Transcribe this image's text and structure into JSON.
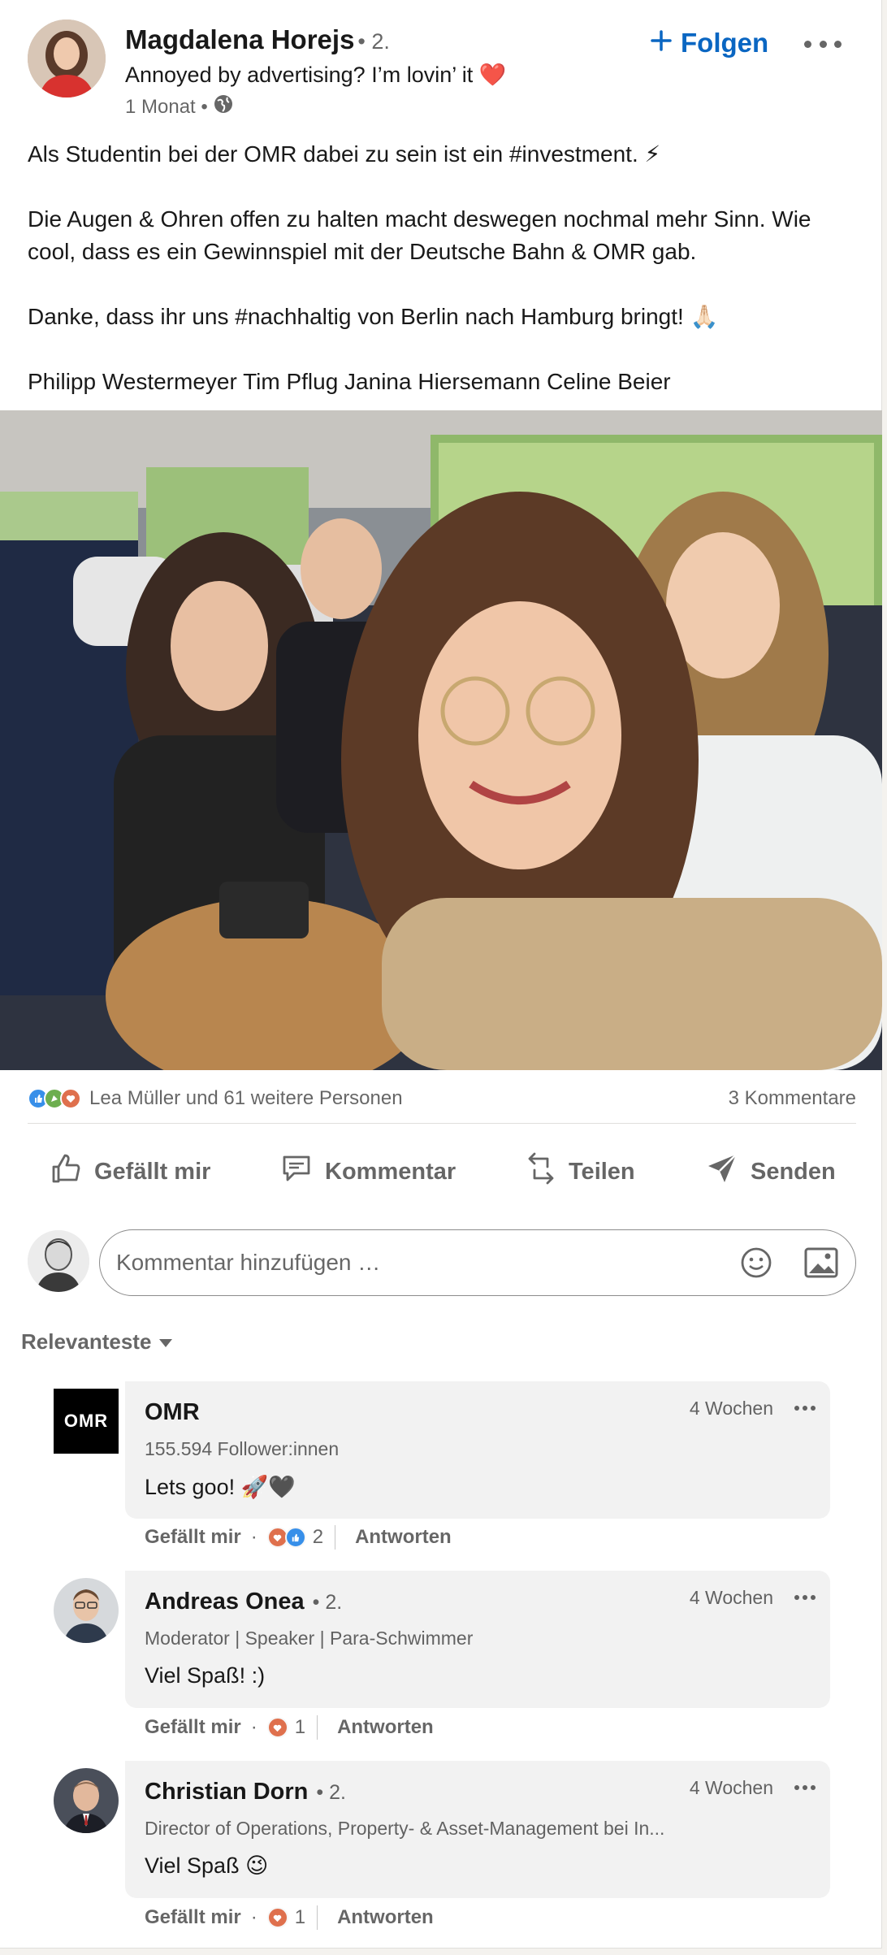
{
  "post": {
    "author": {
      "name": "Magdalena Horejs",
      "degree": "• 2.",
      "headline": "Annoyed by advertising? I’m lovin’ it ❤️",
      "time": "1 Monat •"
    },
    "follow_label": "Folgen",
    "body": [
      "Als Studentin bei der OMR dabei zu sein ist ein #investment. ⚡",
      "Die Augen & Ohren offen zu halten macht deswegen nochmal mehr Sinn. Wie cool, dass es ein Gewinnspiel mit der Deutsche Bahn & OMR gab.",
      "Danke, dass ihr uns #nachhaltig von Berlin nach Hamburg bringt! 🙏🏻",
      "Philipp Westermeyer Tim Pflug Janina Hiersemann Celine Beier"
    ],
    "reactions_text": "Lea Müller und 61 weitere Personen",
    "comments_count": "3 Kommentare"
  },
  "actions": {
    "like": "Gefällt mir",
    "comment": "Kommentar",
    "share": "Teilen",
    "send": "Senden"
  },
  "comment_input": {
    "placeholder": "Kommentar hinzufügen …"
  },
  "sort_label": "Relevanteste",
  "comments": [
    {
      "name": "OMR",
      "degree": "",
      "subtitle": "155.594 Follower:innen",
      "text": "Lets goo! 🚀🖤",
      "time": "4 Wochen",
      "like": "Gefällt mir",
      "dot": "·",
      "reaction_count": "2",
      "reply": "Antworten",
      "logo_text": "OMR"
    },
    {
      "name": "Andreas Onea",
      "degree": "• 2.",
      "subtitle": "Moderator | Speaker | Para-Schwimmer",
      "text": "Viel Spaß! :)",
      "time": "4 Wochen",
      "like": "Gefällt mir",
      "dot": "·",
      "reaction_count": "1",
      "reply": "Antworten"
    },
    {
      "name": "Christian Dorn",
      "degree": "• 2.",
      "subtitle": "Director of Operations, Property- & Asset-Management bei In...",
      "text": "Viel Spaß 😉",
      "time": "4 Wochen",
      "like": "Gefällt mir",
      "dot": "·",
      "reaction_count": "1",
      "reply": "Antworten"
    }
  ],
  "colors": {
    "accent": "#0a66c2",
    "celebrate": "#6dae4f",
    "love": "#df704d",
    "like": "#378fe9"
  }
}
